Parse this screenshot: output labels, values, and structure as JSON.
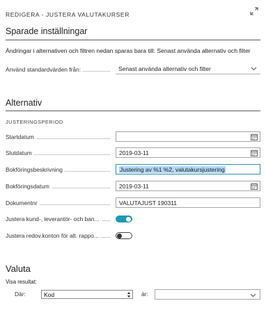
{
  "dialog": {
    "title": "REDIGERA - JUSTERA VALUTAKURSER",
    "expand_icon": "expand-icon"
  },
  "saved_settings": {
    "heading": "Sparade inställningar",
    "info": "Ändringar i alternativen och filtren nedan sparas bara till: Senast använda alternativ och filter",
    "defaults_label": "Använd standardvärden från:",
    "defaults_value": "Senast använda alternativ och filter"
  },
  "options": {
    "heading": "Alternativ",
    "group_caption": "JUSTERINGSPERIOD",
    "fields": {
      "start_date": {
        "label": "Startdatum",
        "value": ""
      },
      "end_date": {
        "label": "Slutdatum",
        "value": "2019-03-11"
      },
      "posting_description": {
        "label": "Bokföringsbeskrivning",
        "value": "Justering av %1 %2, valutakursjustering"
      },
      "posting_date": {
        "label": "Bokföringsdatum",
        "value": "2019-03-11"
      },
      "document_no": {
        "label": "Dokumentnr",
        "value": "VALUTAJUST 190311"
      },
      "adjust_customer": {
        "label": "Justera kund-, leverantör- och ban...",
        "checked": true
      },
      "adjust_gl": {
        "label": "Justera redov.konton för alt. rappo...",
        "checked": false
      }
    }
  },
  "currency": {
    "heading": "Valuta",
    "show_results": "Visa resultat:",
    "where_label": "Där:",
    "field_value": "Kod",
    "is_label": "är:",
    "filter_value": ""
  },
  "colors": {
    "accent": "#1a9ab0",
    "focus_border": "#2f8fb0",
    "selection": "#b3d7f5"
  }
}
